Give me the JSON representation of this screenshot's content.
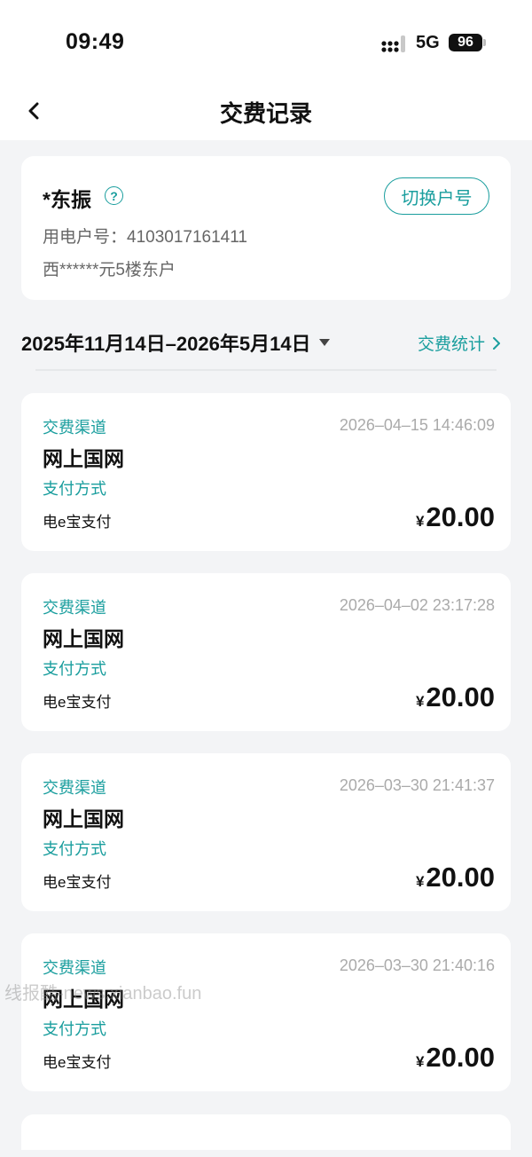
{
  "status_bar": {
    "time": "09:49",
    "network": "5G",
    "battery": "96"
  },
  "header": {
    "title": "交费记录",
    "back_icon": "chevron-left-icon"
  },
  "account": {
    "name": "*东振",
    "help_symbol": "?",
    "switch_label": "切换户号",
    "account_number": "用电户号：4103017161411",
    "address": "西******元5楼东户"
  },
  "filter": {
    "date_range": "2025年11月14日–2026年5月14日",
    "stats_label": "交费统计"
  },
  "records": [
    {
      "channel_label": "交费渠道",
      "time": "2026–04–15 14:46:09",
      "channel": "网上国网",
      "pay_label": "支付方式",
      "pay_method": "电e宝支付",
      "currency": "¥",
      "amount": "20.00"
    },
    {
      "channel_label": "交费渠道",
      "time": "2026–04–02 23:17:28",
      "channel": "网上国网",
      "pay_label": "支付方式",
      "pay_method": "电e宝支付",
      "currency": "¥",
      "amount": "20.00"
    },
    {
      "channel_label": "交费渠道",
      "time": "2026–03–30 21:41:37",
      "channel": "网上国网",
      "pay_label": "支付方式",
      "pay_method": "电e宝支付",
      "currency": "¥",
      "amount": "20.00"
    },
    {
      "channel_label": "交费渠道",
      "time": "2026–03–30 21:40:16",
      "channel": "网上国网",
      "pay_label": "支付方式",
      "pay_method": "电e宝支付",
      "currency": "¥",
      "amount": "20.00"
    }
  ],
  "watermark": "线报酷-news.xianbao.fun",
  "colors": {
    "accent": "#1a9e9e",
    "background": "#f3f4f6"
  }
}
